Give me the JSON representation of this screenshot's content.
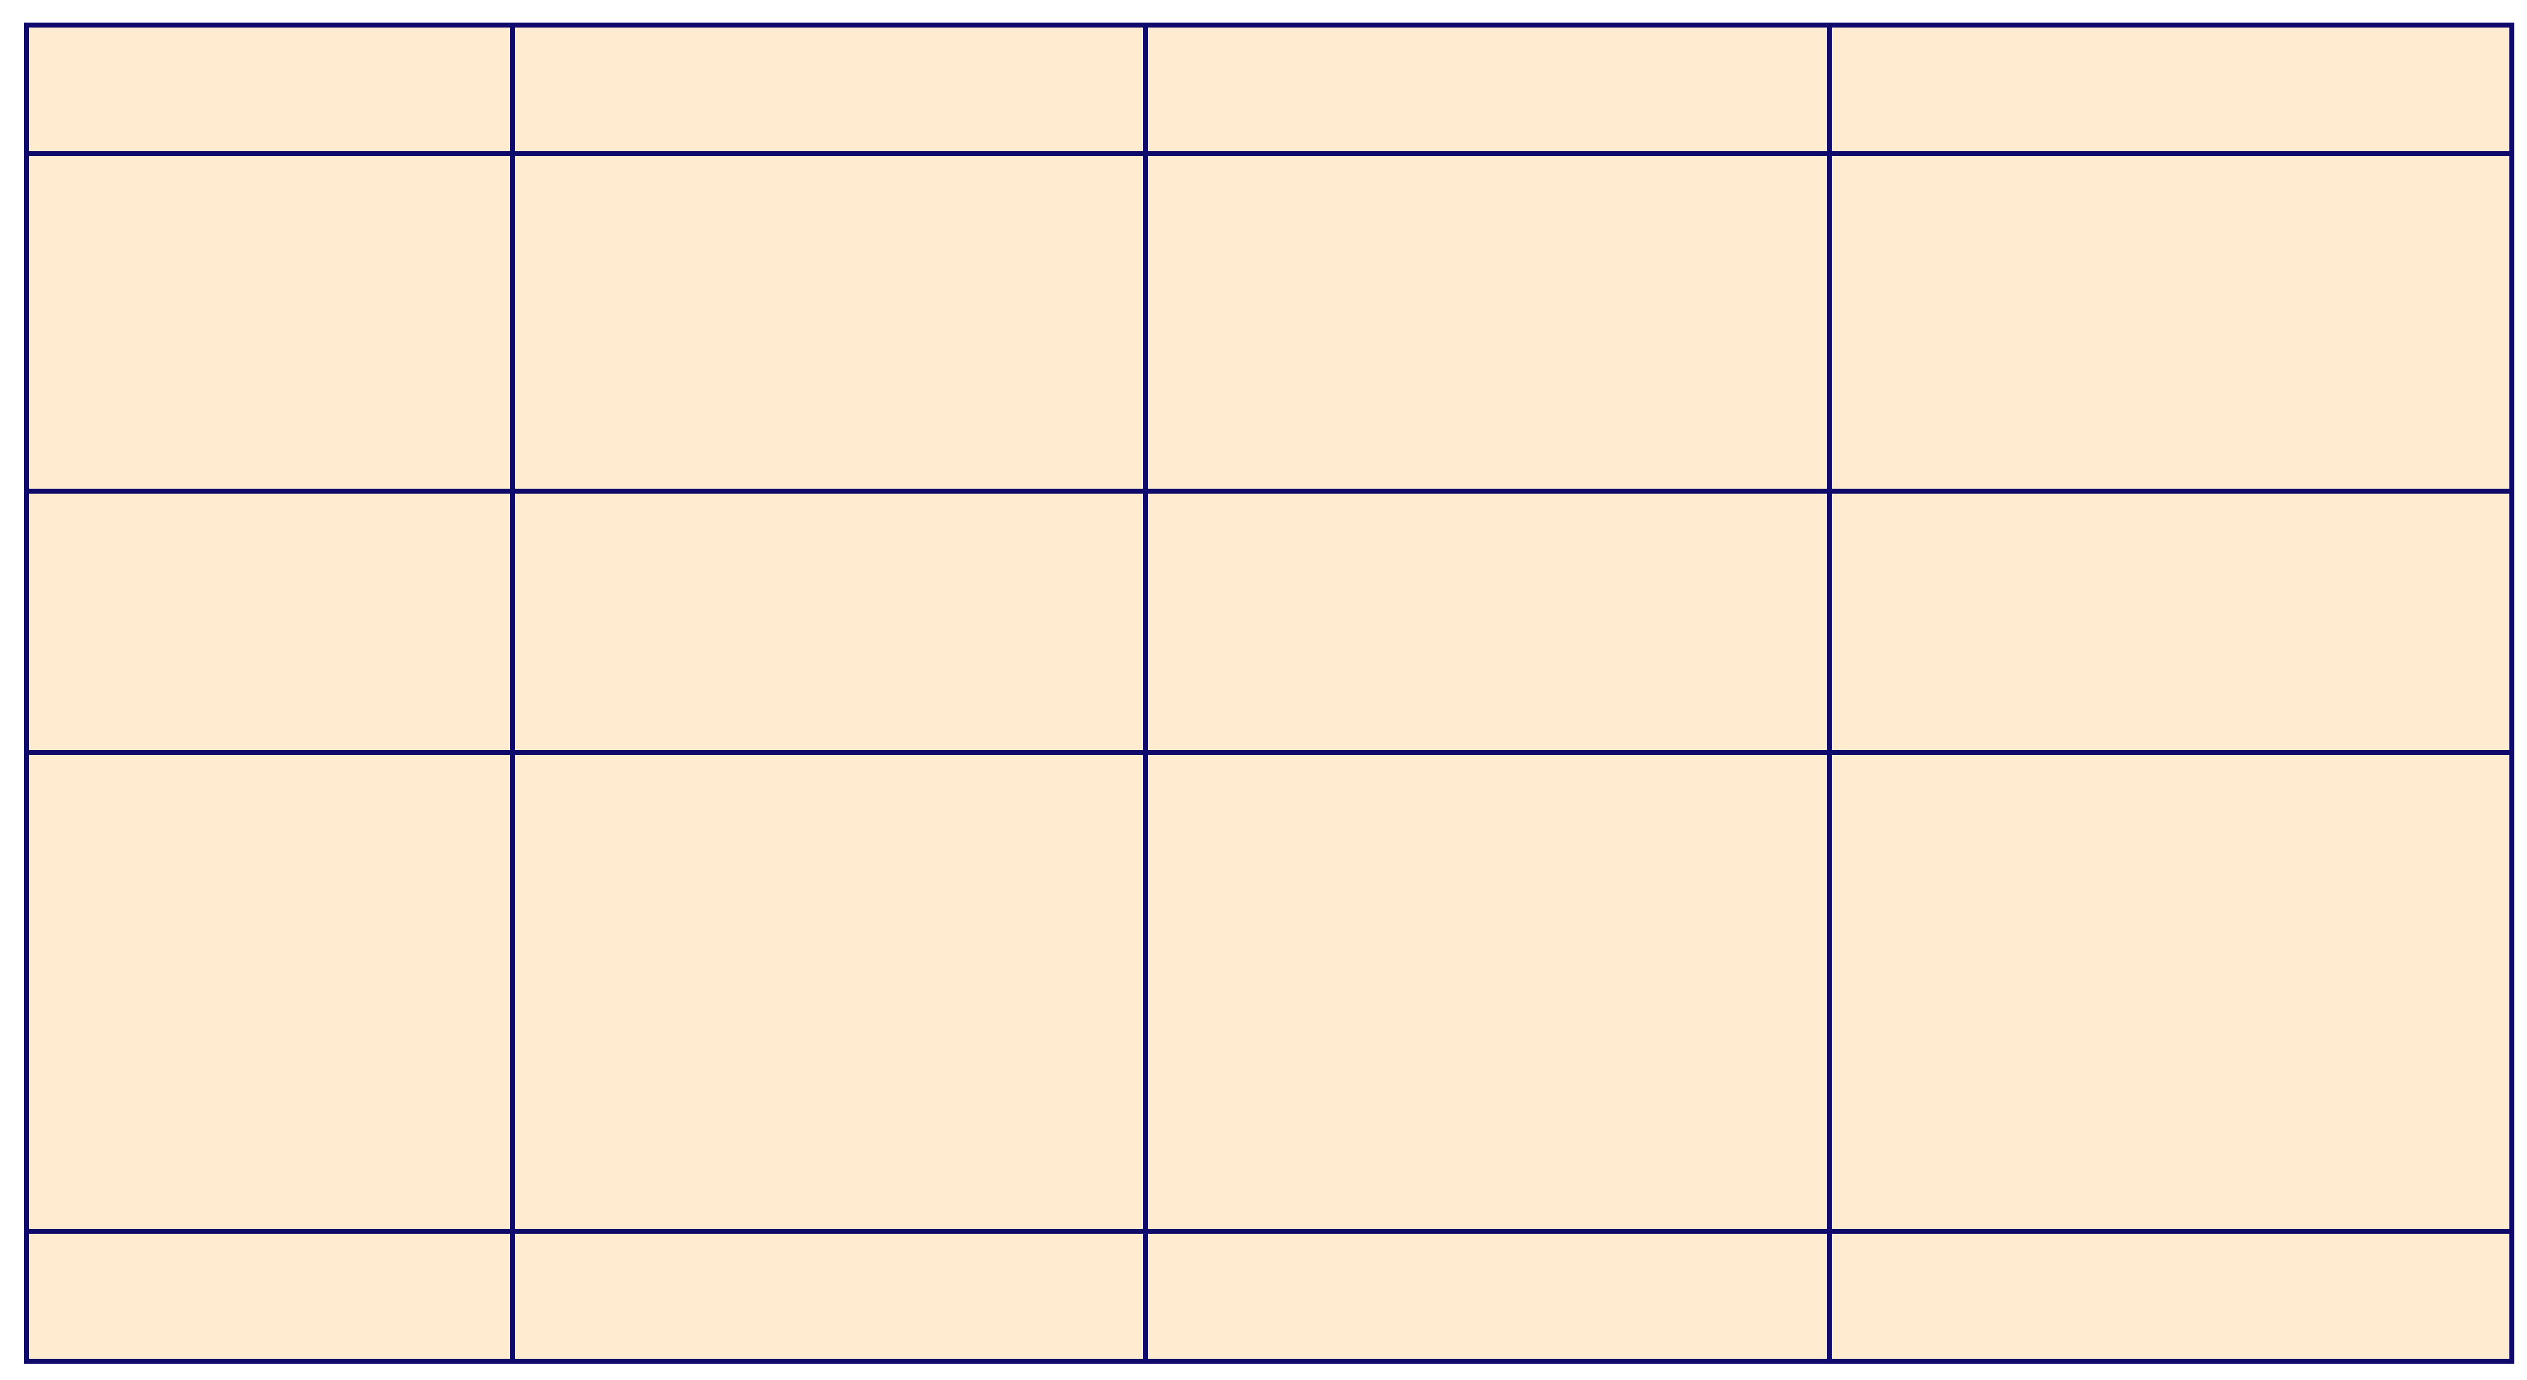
{
  "table": {
    "colors": {
      "cell_fill": "#FEEBD0",
      "border": "#0F0A6B"
    },
    "columns": 4,
    "rows": [
      [
        "",
        "",
        "",
        ""
      ],
      [
        "",
        "",
        "",
        ""
      ],
      [
        "",
        "",
        "",
        ""
      ],
      [
        "",
        "",
        "",
        ""
      ],
      [
        "",
        "",
        "",
        ""
      ]
    ]
  }
}
